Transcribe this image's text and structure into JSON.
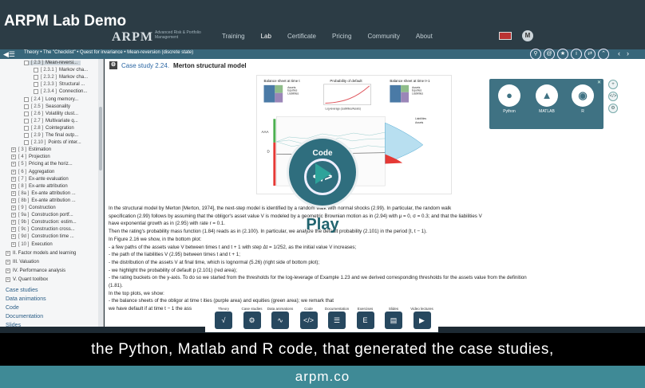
{
  "video": {
    "title": "ARPM Lab Demo"
  },
  "header": {
    "logo": "ARPM",
    "logo_sub": "Advanced Risk & Portfolio Management",
    "nav": [
      "Training",
      "Lab",
      "Certificate",
      "Pricing",
      "Community",
      "About"
    ],
    "avatar": "M"
  },
  "breadcrumb": "Theory • The \"Checklist\" • Quest for invariance • Mean-reversion (discrete state)",
  "sidebar": {
    "tree": [
      {
        "num": "[ 2.3 ]",
        "label": "Mean-reversi...",
        "highlight": true
      },
      {
        "num": "[ 2.3.1 ]",
        "label": "Markov cha..."
      },
      {
        "num": "[ 2.3.2 ]",
        "label": "Markov cha..."
      },
      {
        "num": "[ 2.3.3 ]",
        "label": "Structural ..."
      },
      {
        "num": "[ 2.3.4 ]",
        "label": "Connection..."
      },
      {
        "num": "[ 2.4 ]",
        "label": "Long memory..."
      },
      {
        "num": "[ 2.5 ]",
        "label": "Seasonality"
      },
      {
        "num": "[ 2.6 ]",
        "label": "Volatility clust..."
      },
      {
        "num": "[ 2.7 ]",
        "label": "Multivariate q..."
      },
      {
        "num": "[ 2.8 ]",
        "label": "Cointegration"
      },
      {
        "num": "[ 2.9 ]",
        "label": "The final outp..."
      },
      {
        "num": "[ 2.10 ]",
        "label": "Points of inter..."
      },
      {
        "num": "[ 3 ]",
        "label": "Estimation"
      },
      {
        "num": "[ 4 ]",
        "label": "Projection"
      },
      {
        "num": "[ 5 ]",
        "label": "Pricing at the horiz..."
      },
      {
        "num": "[ 6 ]",
        "label": "Aggregation"
      },
      {
        "num": "[ 7 ]",
        "label": "Ex-ante evaluation"
      },
      {
        "num": "[ 8 ]",
        "label": "Ex-ante attribution"
      },
      {
        "num": "[ 8a ]",
        "label": "Ex-ante attribution ..."
      },
      {
        "num": "[ 8b ]",
        "label": "Ex-ante attribution ..."
      },
      {
        "num": "[ 9 ]",
        "label": "Construction"
      },
      {
        "num": "[ 9a ]",
        "label": "Construction portf..."
      },
      {
        "num": "[ 9b ]",
        "label": "Construction: estim..."
      },
      {
        "num": "[ 9c ]",
        "label": "Construction cross..."
      },
      {
        "num": "[ 9d ]",
        "label": "Construction time ..."
      },
      {
        "num": "[ 10 ]",
        "label": "Execution"
      }
    ],
    "sections": [
      "II. Factor models and learning",
      "III. Valuation",
      "IV. Performance analysis",
      "V. Quant toolbox"
    ],
    "links": [
      "Case studies",
      "Data animations",
      "Code",
      "Documentation",
      "Slides"
    ]
  },
  "main": {
    "case_label": "Case study 2.24.",
    "case_title": "Merton structural model",
    "paragraphs": [
      "In the structural model by Merton [Merton, 1974], the next-step model is identified by a random walk with normal shocks (2.99). In particular, the random walk",
      "specification (2.99) follows by assuming that the obligor's asset value V is modeled by a geometric Brownian motion as in (2.94) with μ = 0, σ = 0.3; and that the liabilities V",
      "have exponential growth as in (2.95) with rate r = 0.1.",
      "Then the rating's probability mass function (1.84) reads as in (2.100). In particular, we analyze the default probability (2.101) in the period [t, t − 1).",
      "In Figure 2.16 we show, in the bottom plot:",
      "- a few paths of the assets value V between times t and t + 1 with step Δt = 1/252, as the initial value V increases;",
      "- the path of the liabilities V (2.95) between times t and t + 1;",
      "- the distribution of the assets V at final time, which is lognormal (5.26) (right side of bottom plot);",
      "- we highlight the probability of default p (2.101) (red area);",
      "- the rating buckets on the y-axis. To do so we started from the thresholds for the log-leverage of Example 1.23 and we derived corresponding thresholds for the assets value from the definition",
      "(1.81).",
      "In the top plots, we show:",
      "- the balance sheets of the obligor at time t                                                                                                     ities (purple area) and equities (green area); we remark that",
      "we have default if at time t − 1 the ass"
    ]
  },
  "code_popup": {
    "languages": [
      "Python",
      "MATLAB",
      "R"
    ]
  },
  "play_overlay": {
    "title": "Code",
    "label": "Play"
  },
  "toolbar": {
    "items": [
      "Theory",
      "Case studies",
      "Data animations",
      "Code",
      "Documentation",
      "Exercises",
      "Slides",
      "Video lectures"
    ]
  },
  "subtitle": "the Python, Matlab and R code, that generated the case studies,",
  "footer": "arpm.co",
  "chart_data": [
    {
      "type": "bar",
      "title": "Balance sheet at time t",
      "series": [
        {
          "name": "Assets"
        },
        {
          "name": "Equities"
        },
        {
          "name": "Liabilities"
        }
      ]
    },
    {
      "type": "line",
      "title": "Probability of default",
      "xlabel": "Log-leverage (Liabilities/Assets)"
    },
    {
      "type": "bar",
      "title": "Balance sheet at time t+1",
      "series": [
        {
          "name": "Assets"
        },
        {
          "name": "Equities"
        },
        {
          "name": "Liabilities"
        }
      ]
    },
    {
      "type": "area",
      "categories": [
        "AAA",
        "D"
      ],
      "series": [
        {
          "name": "Liabilities"
        },
        {
          "name": "Assets"
        }
      ]
    }
  ],
  "colors": {
    "accent": "#3f8a96",
    "nav": "#2c3c45",
    "crumb": "#37667a",
    "popup": "#3f7283"
  }
}
